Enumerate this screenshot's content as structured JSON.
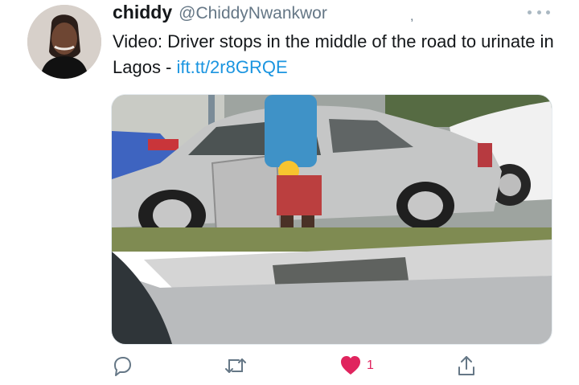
{
  "tweet": {
    "display_name": "chiddy",
    "handle": "@ChiddyNwankwor",
    "tiny_mark": ",",
    "text_prefix": "Video: Driver stops in the middle of the road to urinate in Lagos - ",
    "link_text": "ift.tt/2r8GRQE",
    "media_description": "photo-of-man-beside-silver-car-on-road-median"
  },
  "actions": {
    "like_count": "1",
    "reply_icon": "reply-icon",
    "retweet_icon": "retweet-icon",
    "like_icon": "heart-icon",
    "share_icon": "share-icon"
  },
  "colors": {
    "text": "#14171a",
    "secondary": "#657786",
    "link": "#1b95e0",
    "like": "#e0245e"
  }
}
